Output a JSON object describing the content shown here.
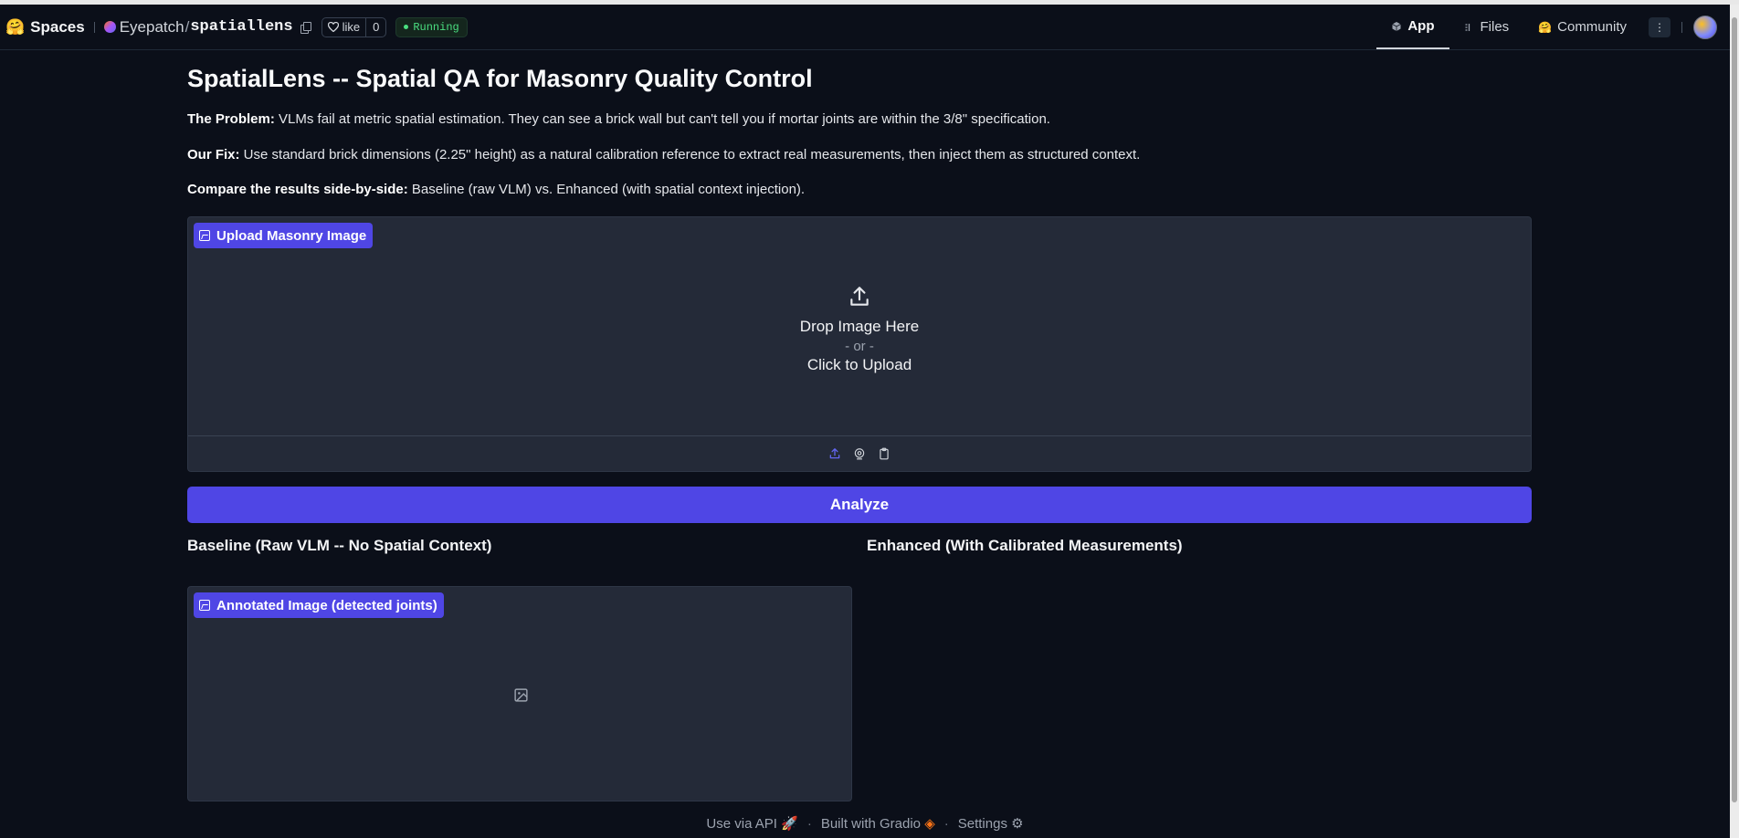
{
  "header": {
    "spaces_label": "Spaces",
    "owner": "Eyepatch",
    "separator": "/",
    "repo": "spatiallens",
    "like_label": "like",
    "like_count": "0",
    "status": "Running",
    "tabs": [
      {
        "label": "App",
        "icon": "cube-icon",
        "active": true
      },
      {
        "label": "Files",
        "icon": "files-icon",
        "active": false
      },
      {
        "label": "Community",
        "icon": "community-icon",
        "active": false
      }
    ],
    "more_icon": "⋮"
  },
  "main": {
    "title": "SpatialLens -- Spatial QA for Masonry Quality Control",
    "problem_label": "The Problem:",
    "problem_text": " VLMs fail at metric spatial estimation. They can see a brick wall but can't tell you if mortar joints are within the 3/8\" specification.",
    "fix_label": "Our Fix:",
    "fix_text": " Use standard brick dimensions (2.25\" height) as a natural calibration reference to extract real measurements, then inject them as structured context.",
    "compare_label": "Compare the results side-by-side:",
    "compare_text": " Baseline (raw VLM) vs. Enhanced (with spatial context injection).",
    "upload": {
      "label": "Upload Masonry Image",
      "drop_text": "Drop Image Here",
      "or_text": "- or -",
      "click_text": "Click to Upload"
    },
    "analyze_label": "Analyze",
    "baseline_heading": "Baseline (Raw VLM -- No Spatial Context)",
    "enhanced_heading": "Enhanced (With Calibrated Measurements)",
    "annotated_label": "Annotated Image (detected joints)"
  },
  "footer": {
    "api_label": "Use via API",
    "built_label": "Built with Gradio",
    "settings_label": "Settings",
    "dot": "·"
  },
  "colors": {
    "background": "#0b0f19",
    "panel": "#242a38",
    "accent": "#4f46e5",
    "running": "#4ade80"
  }
}
